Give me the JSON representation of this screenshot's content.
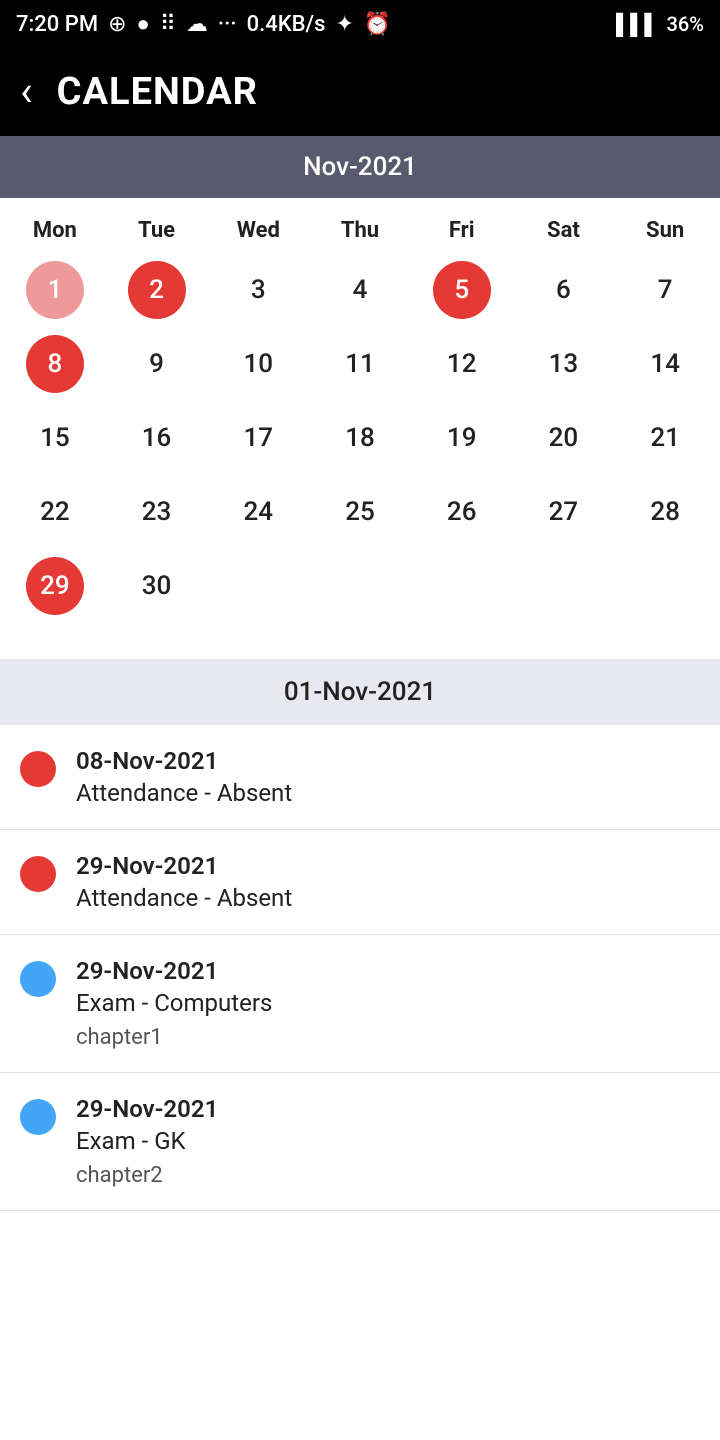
{
  "statusBar": {
    "time": "7:20 PM",
    "network": "0.4KB/s",
    "battery": "36%"
  },
  "header": {
    "back_label": "‹",
    "title": "CALENDAR"
  },
  "calendar": {
    "month_label": "Nov-2021",
    "weekdays": [
      "Mon",
      "Tue",
      "Wed",
      "Thu",
      "Fri",
      "Sat",
      "Sun"
    ],
    "days": [
      {
        "day": "1",
        "style": "red-light",
        "empty": false
      },
      {
        "day": "2",
        "style": "red-solid",
        "empty": false
      },
      {
        "day": "3",
        "style": "plain",
        "empty": false
      },
      {
        "day": "4",
        "style": "plain",
        "empty": false
      },
      {
        "day": "5",
        "style": "red-solid",
        "empty": false
      },
      {
        "day": "6",
        "style": "plain",
        "empty": false
      },
      {
        "day": "7",
        "style": "plain",
        "empty": false
      },
      {
        "day": "8",
        "style": "red-solid",
        "empty": false
      },
      {
        "day": "9",
        "style": "plain",
        "empty": false
      },
      {
        "day": "10",
        "style": "plain",
        "empty": false
      },
      {
        "day": "11",
        "style": "plain",
        "empty": false
      },
      {
        "day": "12",
        "style": "plain",
        "empty": false
      },
      {
        "day": "13",
        "style": "plain",
        "empty": false
      },
      {
        "day": "14",
        "style": "plain",
        "empty": false
      },
      {
        "day": "15",
        "style": "plain",
        "empty": false
      },
      {
        "day": "16",
        "style": "plain",
        "empty": false
      },
      {
        "day": "17",
        "style": "plain",
        "empty": false
      },
      {
        "day": "18",
        "style": "plain",
        "empty": false
      },
      {
        "day": "19",
        "style": "plain",
        "empty": false
      },
      {
        "day": "20",
        "style": "plain",
        "empty": false
      },
      {
        "day": "21",
        "style": "plain",
        "empty": false
      },
      {
        "day": "22",
        "style": "plain",
        "empty": false
      },
      {
        "day": "23",
        "style": "plain",
        "empty": false
      },
      {
        "day": "24",
        "style": "plain",
        "empty": false
      },
      {
        "day": "25",
        "style": "plain",
        "empty": false
      },
      {
        "day": "26",
        "style": "plain",
        "empty": false
      },
      {
        "day": "27",
        "style": "plain",
        "empty": false
      },
      {
        "day": "28",
        "style": "plain",
        "empty": false
      },
      {
        "day": "29",
        "style": "red-solid",
        "empty": false
      },
      {
        "day": "30",
        "style": "plain",
        "empty": false
      }
    ]
  },
  "events": {
    "selected_date": "01-Nov-2021",
    "items": [
      {
        "dot_color": "red",
        "date": "08-Nov-2021",
        "title": "Attendance - Absent",
        "subtitle": ""
      },
      {
        "dot_color": "red",
        "date": "29-Nov-2021",
        "title": "Attendance - Absent",
        "subtitle": ""
      },
      {
        "dot_color": "blue",
        "date": "29-Nov-2021",
        "title": "Exam - Computers",
        "subtitle": "chapter1"
      },
      {
        "dot_color": "blue",
        "date": "29-Nov-2021",
        "title": "Exam - GK",
        "subtitle": "chapter2"
      }
    ]
  }
}
